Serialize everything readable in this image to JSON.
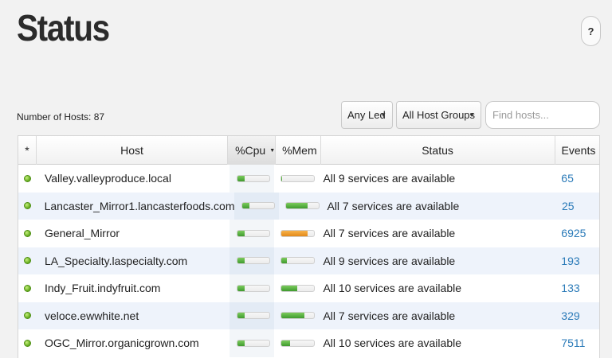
{
  "page": {
    "title": "Status",
    "help_label": "?"
  },
  "toolbar": {
    "host_count_label": "Number of Hosts: 87",
    "led_filter": "Any Led",
    "group_filter": "All Host Groups",
    "search_placeholder": "Find hosts..."
  },
  "table": {
    "columns": [
      "*",
      "Host",
      "%Cpu",
      "%Mem",
      "Status",
      "Events"
    ],
    "sorted_column": "%Cpu",
    "rows": [
      {
        "led": "green",
        "host": "Valley.valleyproduce.local",
        "cpu": 0.22,
        "mem": 0.04,
        "mem_color": "green",
        "status": "All 9 services are available",
        "events": "65"
      },
      {
        "led": "green",
        "host": "Lancaster_Mirror1.lancasterfoods.com",
        "cpu": 0.22,
        "mem": 0.68,
        "mem_color": "green",
        "status": "All 7 services are available",
        "events": "25"
      },
      {
        "led": "green",
        "host": "General_Mirror",
        "cpu": 0.22,
        "mem": 0.82,
        "mem_color": "orange",
        "status": "All 7 services are available",
        "events": "6925"
      },
      {
        "led": "green",
        "host": "LA_Specialty.laspecialty.com",
        "cpu": 0.22,
        "mem": 0.18,
        "mem_color": "green",
        "status": "All 9 services are available",
        "events": "193"
      },
      {
        "led": "green",
        "host": "Indy_Fruit.indyfruit.com",
        "cpu": 0.22,
        "mem": 0.5,
        "mem_color": "green",
        "status": "All 10 services are available",
        "events": "133"
      },
      {
        "led": "green",
        "host": "veloce.ewwhite.net",
        "cpu": 0.22,
        "mem": 0.7,
        "mem_color": "green",
        "status": "All 7 services are available",
        "events": "329"
      },
      {
        "led": "green",
        "host": "OGC_Mirror.organicgrown.com",
        "cpu": 0.22,
        "mem": 0.28,
        "mem_color": "green",
        "status": "All 10 services are available",
        "events": "7511"
      }
    ]
  }
}
